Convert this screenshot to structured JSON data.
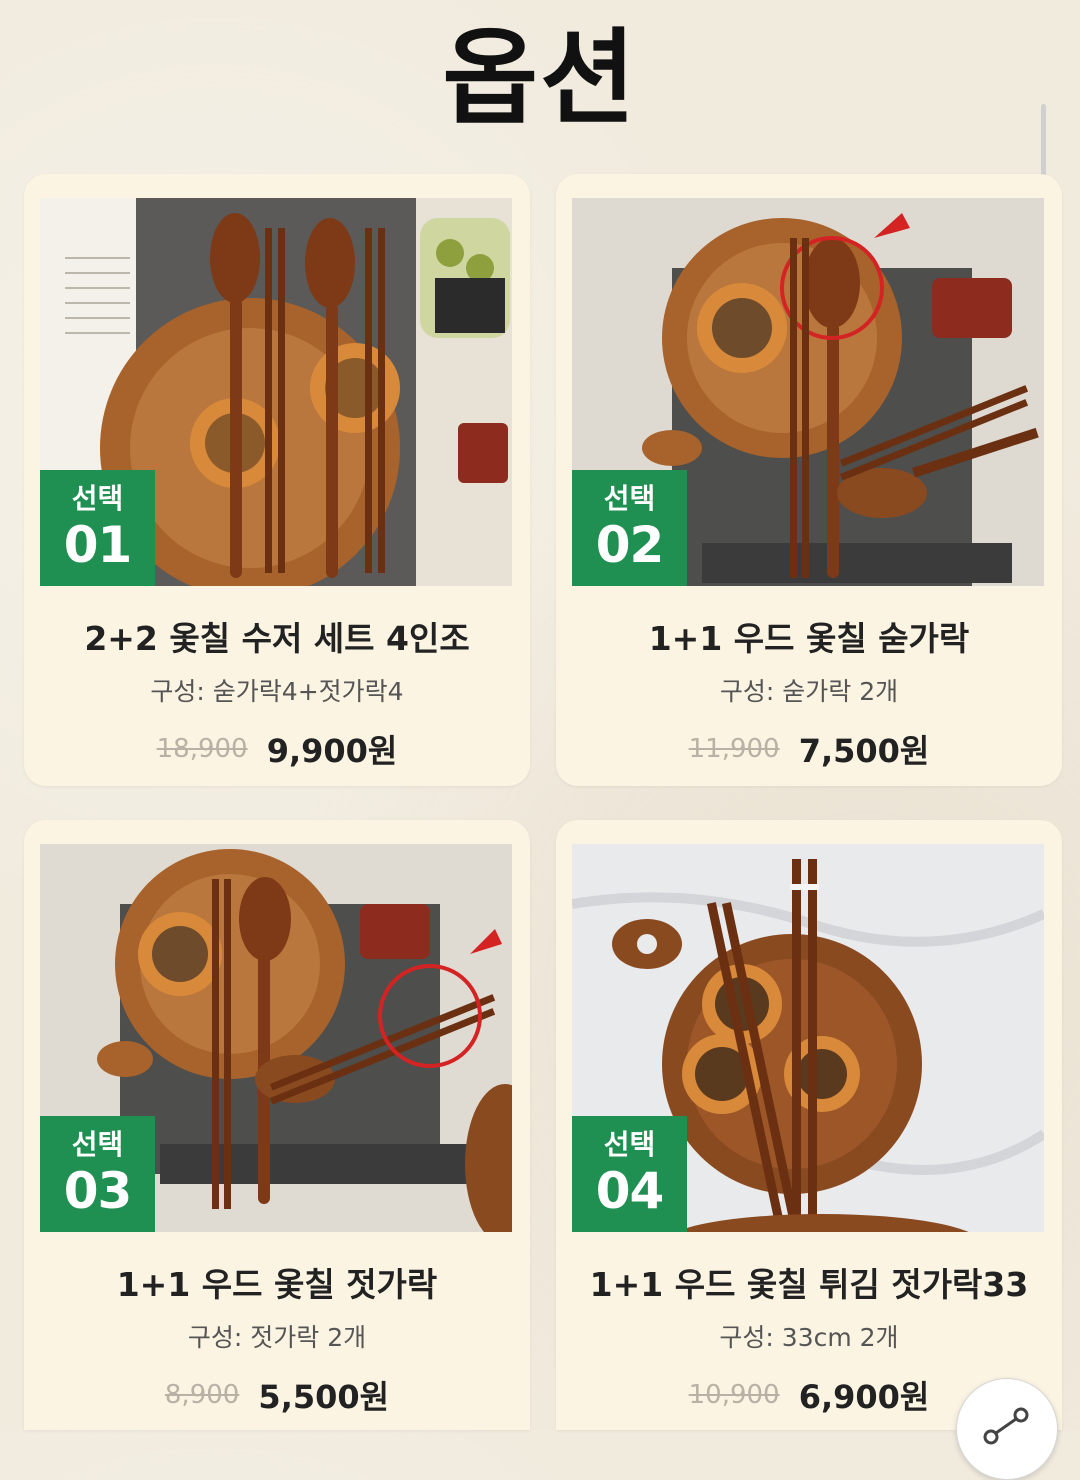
{
  "page_title": "옵션",
  "options": [
    {
      "badge_label": "선택",
      "badge_number": "01",
      "name": "2+2 옻칠 수저 세트 4인조",
      "composition": "구성: 숟가락4+젓가락4",
      "original_price": "18,900",
      "sale_price": "9,900원"
    },
    {
      "badge_label": "선택",
      "badge_number": "02",
      "name": "1+1 우드 옻칠 숟가락",
      "composition": "구성: 숟가락 2개",
      "original_price": "11,900",
      "sale_price": "7,500원"
    },
    {
      "badge_label": "선택",
      "badge_number": "03",
      "name": "1+1 우드 옻칠 젓가락",
      "composition": "구성: 젓가락 2개",
      "original_price": "8,900",
      "sale_price": "5,500원"
    },
    {
      "badge_label": "선택",
      "badge_number": "04",
      "name": "1+1 우드 옻칠 튀김 젓가락33",
      "composition": "구성: 33cm 2개",
      "original_price": "10,900",
      "sale_price": "6,900원"
    }
  ],
  "colors": {
    "badge_green": "#1f8f52",
    "card_bg": "#fbf4e2",
    "page_bg": "#f1ebde",
    "strike_price": "#b8b2a6"
  },
  "icons": {
    "share": "share-icon"
  }
}
